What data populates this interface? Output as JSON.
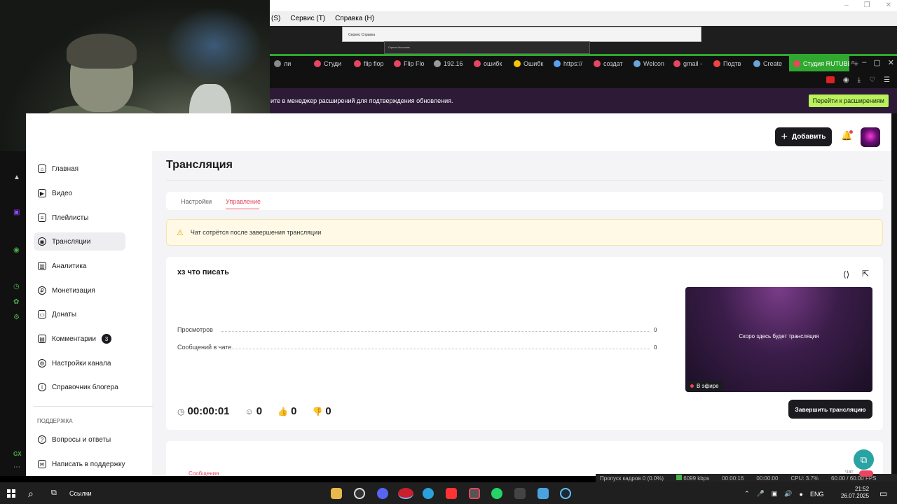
{
  "obs": {
    "menu": [
      "(S)",
      "Сервис (T)",
      "Справка (H)"
    ],
    "inner_menu": "Сервис  Справка",
    "inner_sub": "Сцены  Источник",
    "status": [
      "Пропуск кадров 0 (0.0%)",
      "6099 kbps",
      "00:00:16",
      "00:00:00",
      "CPU: 3.7%",
      "60.00 / 60.00 FPS"
    ]
  },
  "browser": {
    "tabs": [
      {
        "label": "ли",
        "color": "#8a8a8a"
      },
      {
        "label": "Студи",
        "color": "#e94560"
      },
      {
        "label": "flip flop",
        "color": "#e94560"
      },
      {
        "label": "Flip Flo",
        "color": "#e94560"
      },
      {
        "label": "192.16",
        "color": "#9a9a9a"
      },
      {
        "label": "ошибк",
        "color": "#e94560"
      },
      {
        "label": "Ошибк",
        "color": "#f5c400"
      },
      {
        "label": "https://",
        "color": "#5aa0f0"
      },
      {
        "label": "создат",
        "color": "#e94560"
      },
      {
        "label": "Welcon",
        "color": "#6aa4d8"
      },
      {
        "label": "gmail -",
        "color": "#e94560"
      },
      {
        "label": "Подтв",
        "color": "#e44"
      },
      {
        "label": "Create",
        "color": "#6aa4d8"
      },
      {
        "label": "Студия RUTUBE",
        "color": "#e94560"
      }
    ],
    "tab_add": "+",
    "notice_text": "ите в менеджер расширений для подтверждения обновления.",
    "notice_button": "Перейти к расширениям"
  },
  "header": {
    "add_label": "Добавить",
    "add_icon": "+",
    "bell_icon": "🔔"
  },
  "sidebar": {
    "items": [
      {
        "label": "Главная",
        "icon": "⌂"
      },
      {
        "label": "Видео",
        "icon": "▶"
      },
      {
        "label": "Плейлисты",
        "icon": "≡"
      },
      {
        "label": "Трансляции",
        "icon": "◉"
      },
      {
        "label": "Аналитика",
        "icon": "▥"
      },
      {
        "label": "Монетизация",
        "icon": "₽"
      },
      {
        "label": "Донаты",
        "icon": "▭"
      },
      {
        "label": "Комментарии",
        "icon": "▤",
        "badge": "3"
      },
      {
        "label": "Настройки канала",
        "icon": "⚙"
      },
      {
        "label": "Справочник блогера",
        "icon": "i"
      }
    ],
    "support_heading": "ПОДДЕРЖКА",
    "support_items": [
      {
        "label": "Вопросы и ответы",
        "icon": "?"
      },
      {
        "label": "Написать в поддержку",
        "icon": "✉"
      }
    ]
  },
  "main": {
    "title": "Трансляция",
    "tabs": [
      "Настройки",
      "Управление"
    ],
    "notice": "Чат сотрётся после завершения трансляции",
    "stream_name": "хз что писать",
    "stats": [
      {
        "label": "Просмотров",
        "value": "0"
      },
      {
        "label": "Сообщений в чате",
        "value": "0"
      }
    ],
    "preview_text": "Скоро здесь будет трансляция",
    "live_label": "В эфире",
    "metrics": {
      "time": "00:00:01",
      "viewers": "0",
      "likes": "0",
      "dislikes": "0"
    },
    "end_button": "Завершить трансляцию",
    "messages_label": "Сообщения",
    "chat_label": "Чат"
  },
  "taskbar": {
    "links_label": "Ссылки",
    "lang": "ENG",
    "time": "21:52",
    "date": "26.07.2025"
  }
}
